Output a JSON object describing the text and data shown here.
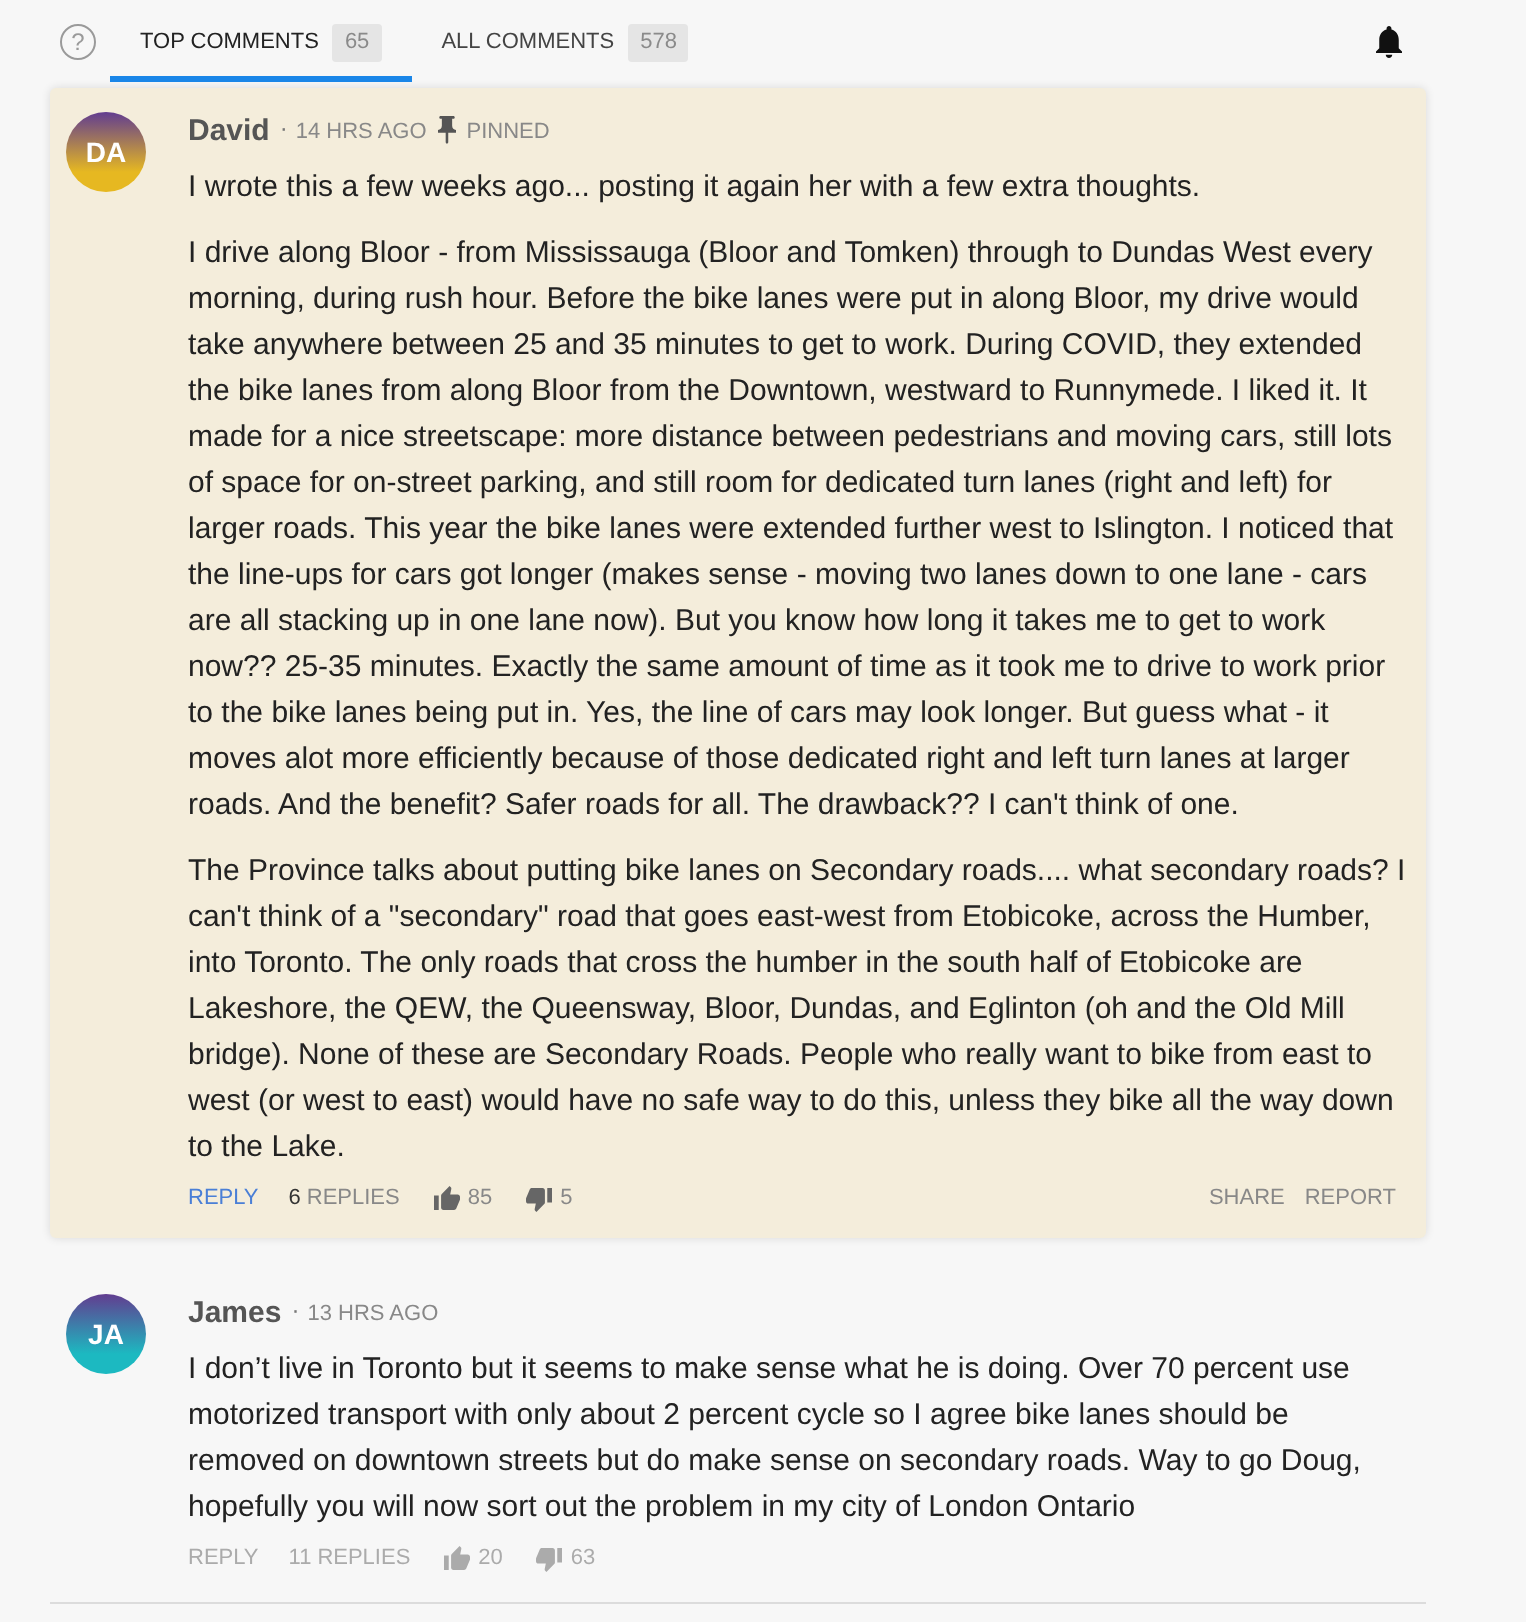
{
  "help_button": "?",
  "tabs": [
    {
      "label": "TOP COMMENTS",
      "count": "65",
      "selected": true
    },
    {
      "label": "ALL COMMENTS",
      "count": "578",
      "selected": false
    }
  ],
  "comments": [
    {
      "initials": "DA",
      "color": "#e6b821",
      "author": "David",
      "separator": "·",
      "time": "14 HRS AGO",
      "pinned": true,
      "pinned_label": "PINNED",
      "paragraphs": [
        "I wrote this a few weeks ago... posting it again her with a few extra thoughts.",
        "I drive along Bloor - from Mississauga (Bloor and Tomken) through to Dundas West every morning, during rush hour. Before the bike lanes were put in along Bloor, my drive would take anywhere between 25 and 35 minutes to get to work. During COVID, they extended the bike lanes from along Bloor from the Downtown, westward to Runnymede. I liked it. It made for a nice streetscape: more distance between pedestrians and moving cars, still lots of space for on-street parking, and still room for dedicated turn lanes (right and left) for larger roads. This year the bike lanes were extended further west to Islington. I noticed that the line-ups for cars got longer (makes sense - moving two lanes down to one lane - cars are all stacking up in one lane now). But you know how long it takes me to get to work now?? 25-35 minutes. Exactly the same amount of time as it took me to drive to work prior to the bike lanes being put in. Yes, the line of cars may look longer. But guess what - it moves alot more efficiently because of those dedicated right and left turn lanes at larger roads. And the benefit? Safer roads for all. The drawback?? I can't think of one.",
        "The Province talks about putting bike lanes on Secondary roads.... what secondary roads? I can't think of a \"secondary\" road that goes east-west from Etobicoke, across the Humber, into Toronto. The only roads that cross the humber in the south half of Etobicoke are Lakeshore, the QEW, the Queensway, Bloor, Dundas, and Eglinton (oh and the Old Mill bridge). None of these are Secondary Roads. People who really want to bike from east to west (or west to east) would have no safe way to do this, unless they bike all the way down to the Lake."
      ],
      "reply": "REPLY",
      "replies_count": "6",
      "replies_label": "REPLIES",
      "likes": "85",
      "dislikes": "5",
      "share": "SHARE",
      "report": "REPORT"
    },
    {
      "initials": "JA",
      "color": "#1cb9c1",
      "author": "James",
      "separator": "·",
      "time": "13 HRS AGO",
      "pinned": false,
      "paragraphs": [
        "I don’t live in Toronto but it seems to make sense what he is doing. Over 70 percent use motorized transport with only about 2 percent cycle so I agree bike lanes should be removed on downtown streets but do make sense on secondary roads. Way to go Doug, hopefully you will now sort out the problem in my city of London Ontario"
      ],
      "reply": "REPLY",
      "replies_count": "11",
      "replies_label": "REPLIES",
      "likes": "20",
      "dislikes": "63"
    }
  ]
}
